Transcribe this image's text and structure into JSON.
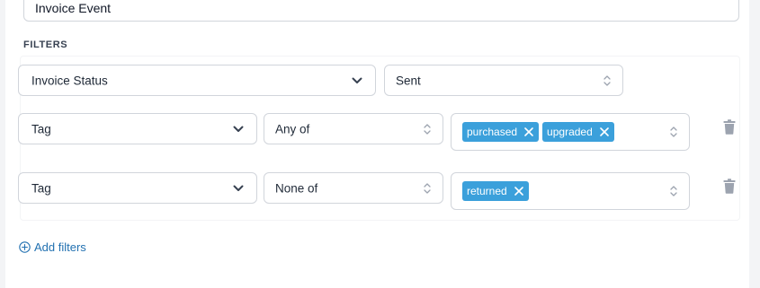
{
  "event_field": {
    "value": "Invoice Event"
  },
  "filters": {
    "section_label": "FILTERS",
    "rows": [
      {
        "field": "Invoice Status",
        "value": "Sent"
      },
      {
        "field": "Tag",
        "operator": "Any of",
        "tags": [
          "purchased",
          "upgraded"
        ]
      },
      {
        "field": "Tag",
        "operator": "None of",
        "tags": [
          "returned"
        ]
      }
    ]
  },
  "add_filters": {
    "label": "Add filters"
  },
  "colors": {
    "accent": "#2271b1",
    "chip": "#3ba0db",
    "border": "#d1d5db"
  },
  "icons": [
    "chevron-down-icon",
    "updown-icon",
    "close-icon",
    "trash-icon",
    "plus-circle-icon"
  ]
}
